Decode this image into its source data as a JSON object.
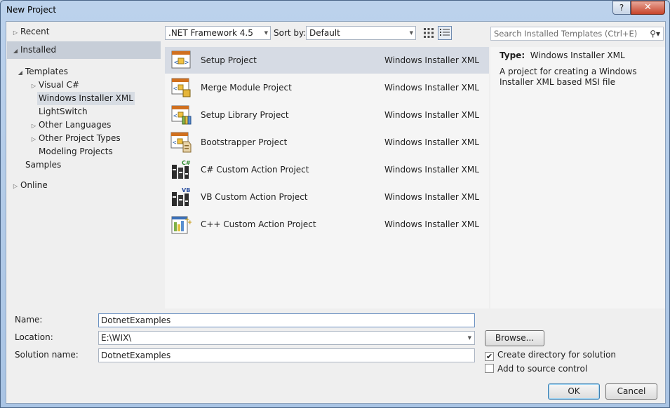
{
  "window": {
    "title": "New Project",
    "help_glyph": "?",
    "close_glyph": "✕"
  },
  "tree": {
    "recent": "Recent",
    "installed": "Installed",
    "templates": "Templates",
    "visual_csharp": "Visual C#",
    "wix": "Windows Installer XML",
    "lightswitch": "LightSwitch",
    "other_languages": "Other Languages",
    "other_project_types": "Other Project Types",
    "modeling_projects": "Modeling Projects",
    "samples": "Samples",
    "online": "Online"
  },
  "toolbar": {
    "framework": ".NET Framework 4.5",
    "sort_label": "Sort by:",
    "sort_value": "Default"
  },
  "search": {
    "placeholder": "Search Installed Templates (Ctrl+E)"
  },
  "templates": [
    {
      "name": "Setup Project",
      "category": "Windows Installer XML",
      "icon": "setup-project-icon"
    },
    {
      "name": "Merge Module Project",
      "category": "Windows Installer XML",
      "icon": "merge-module-icon"
    },
    {
      "name": "Setup Library Project",
      "category": "Windows Installer XML",
      "icon": "setup-library-icon"
    },
    {
      "name": "Bootstrapper Project",
      "category": "Windows Installer XML",
      "icon": "bootstrapper-icon"
    },
    {
      "name": "C# Custom Action Project",
      "category": "Windows Installer XML",
      "icon": "csharp-action-icon",
      "badge": "C#"
    },
    {
      "name": "VB Custom Action Project",
      "category": "Windows Installer XML",
      "icon": "vb-action-icon",
      "badge": "VB"
    },
    {
      "name": "C++ Custom Action Project",
      "category": "Windows Installer XML",
      "icon": "cpp-action-icon"
    }
  ],
  "details": {
    "type_label": "Type:",
    "type_value": "Windows Installer XML",
    "description": "A project for creating a Windows Installer XML based MSI file"
  },
  "form": {
    "name_label": "Name:",
    "name_value": "DotnetExamples",
    "location_label": "Location:",
    "location_value": "E:\\WIX\\",
    "solution_label": "Solution name:",
    "solution_value": "DotnetExamples",
    "browse": "Browse...",
    "create_dir": "Create directory for solution",
    "create_dir_checked": true,
    "source_control": "Add to source control",
    "source_control_checked": false,
    "ok": "OK",
    "cancel": "Cancel"
  },
  "colors": {
    "selection": "#d6dbe4",
    "installed_header": "#c7ced8",
    "title_bar": "#bcd2ec",
    "close_button": "#c7442a"
  }
}
